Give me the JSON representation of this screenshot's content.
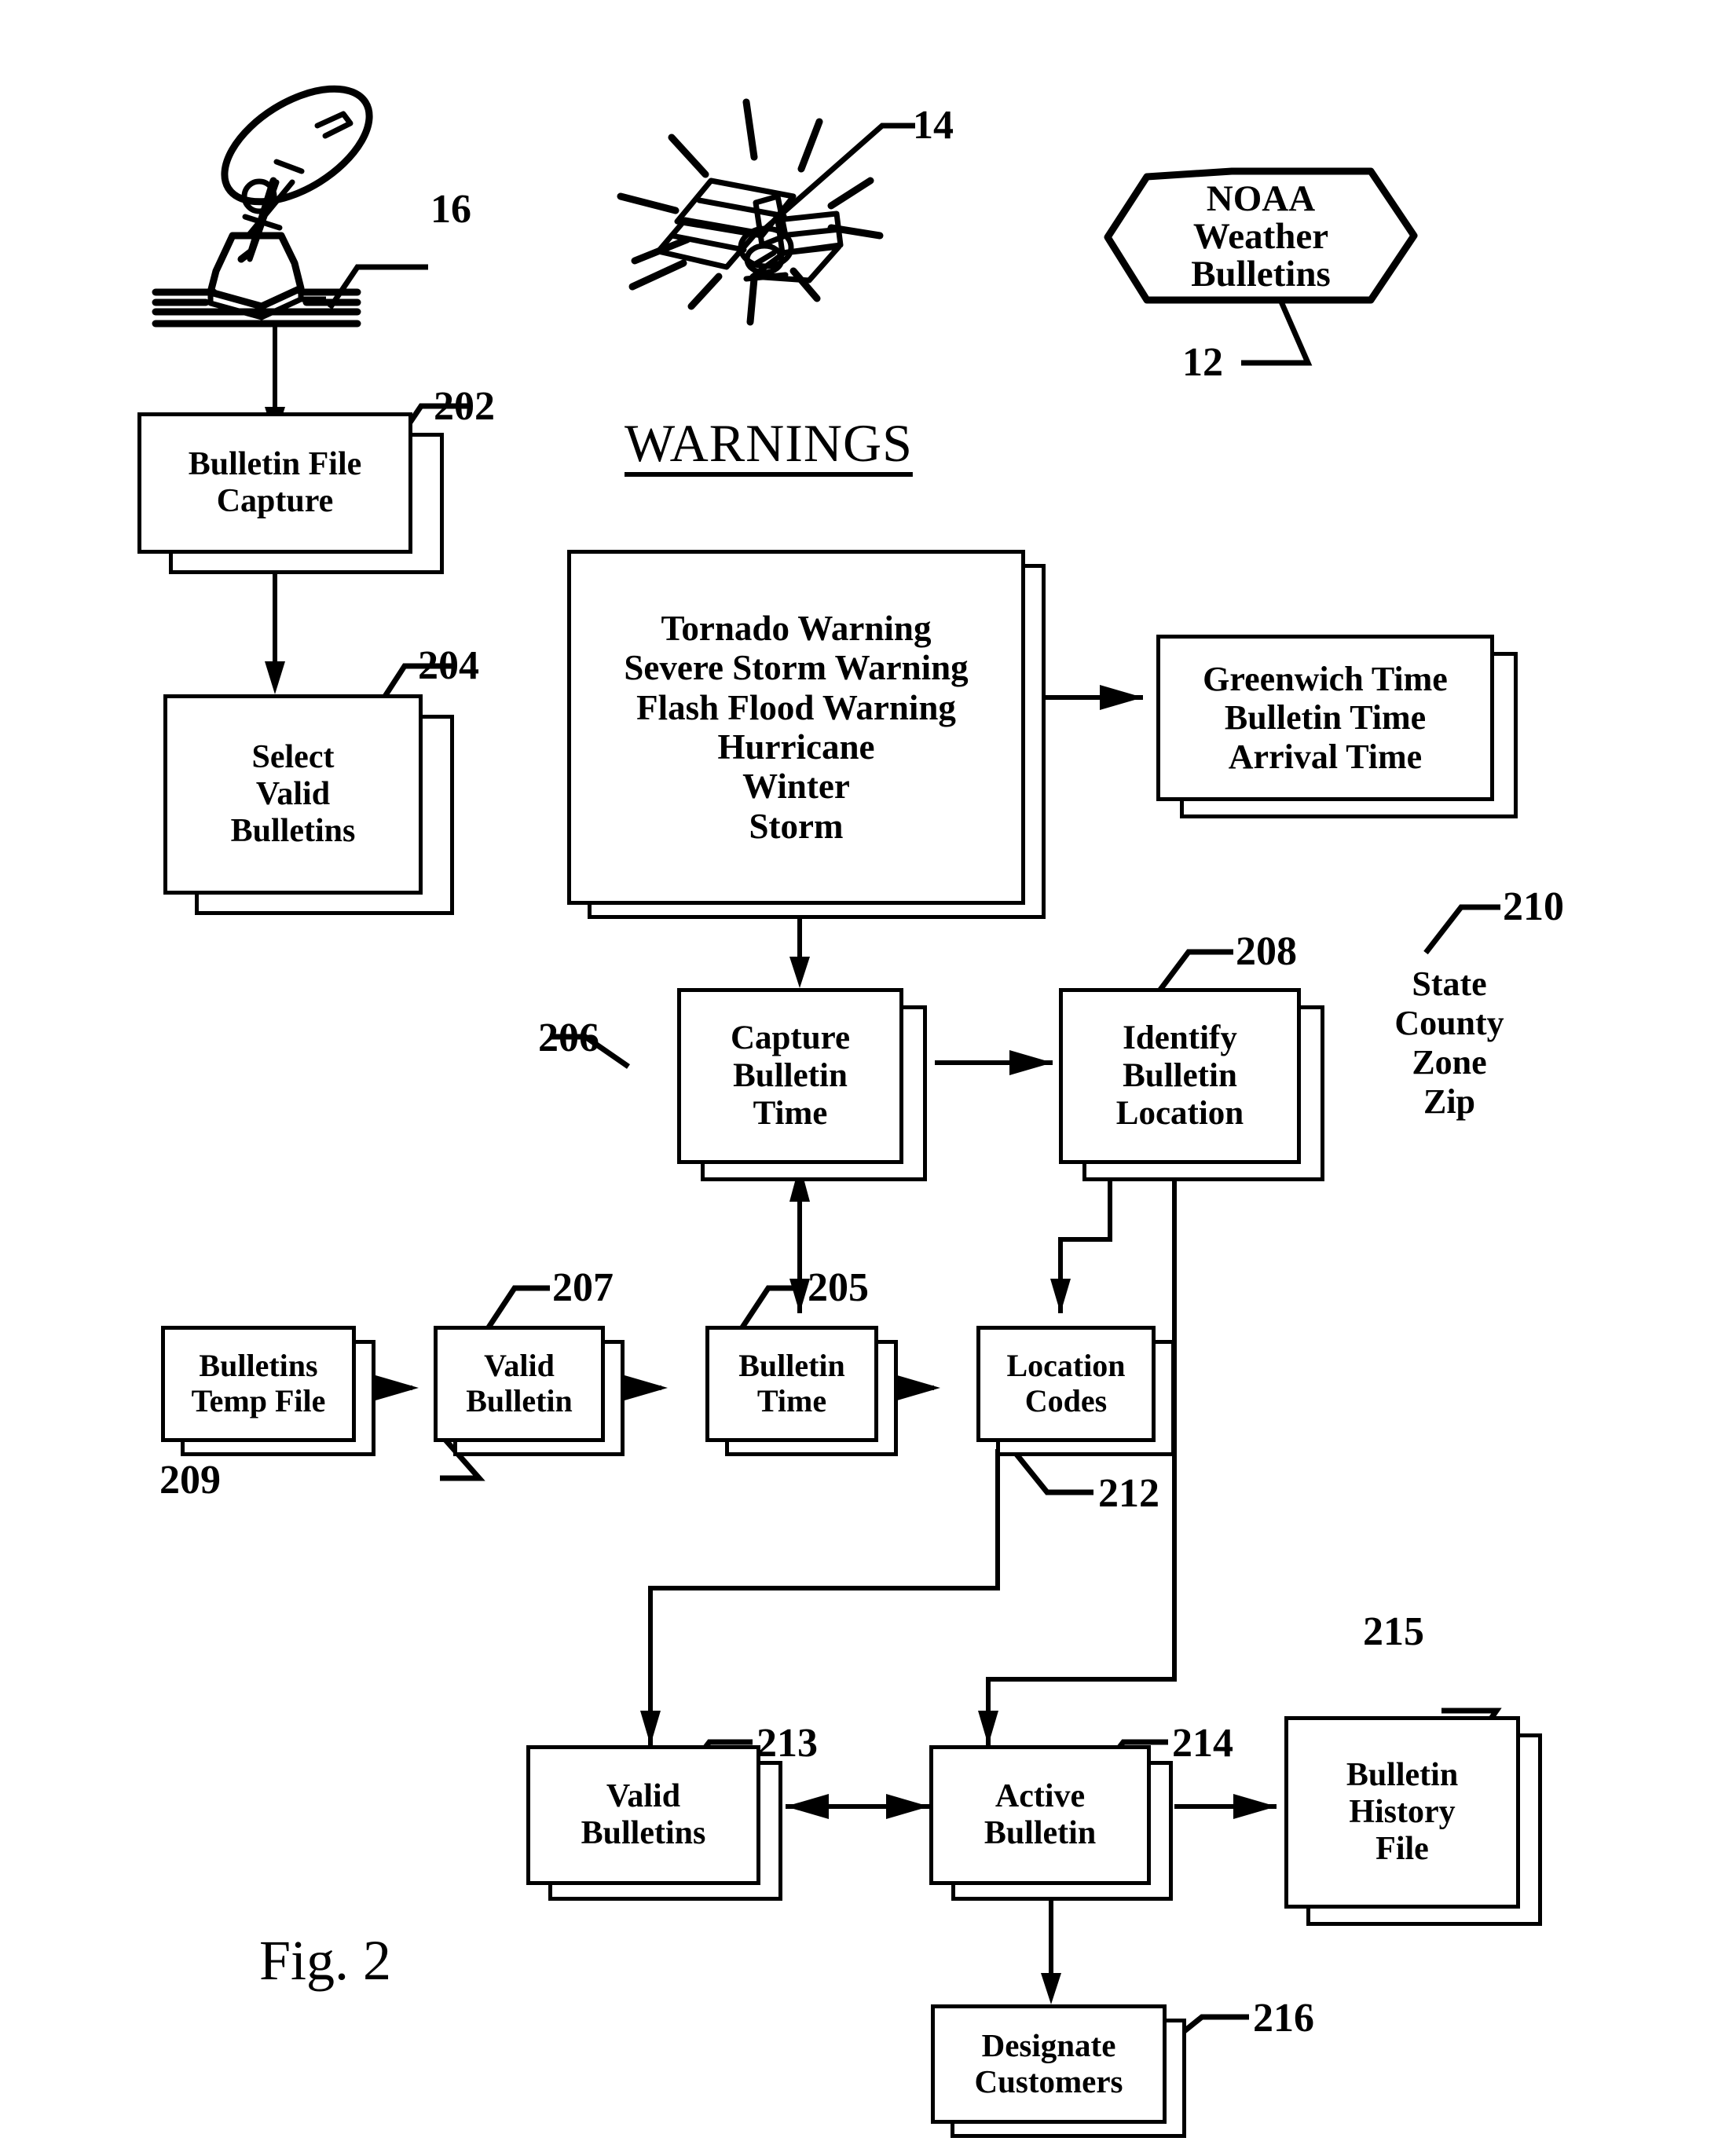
{
  "figure": {
    "label": "Fig. 2",
    "title": "WARNINGS"
  },
  "source_icons": {
    "satellite_dish": {
      "ref": "16",
      "name": "satellite-dish-icon"
    },
    "satellite": {
      "ref": "14",
      "name": "satellite-icon"
    },
    "noaa_badge": {
      "ref": "12",
      "line1": "NOAA",
      "line2": "Weather",
      "line3": "Bulletins"
    }
  },
  "blocks": [
    {
      "id": "b202",
      "ref": "202",
      "text": "Bulletin File\nCapture"
    },
    {
      "id": "b204",
      "ref": "204",
      "text": "Select\nValid\nBulletins"
    },
    {
      "id": "bwarn",
      "ref": "",
      "text": "Tornado Warning\nSevere Storm Warning\nFlash Flood Warning\nHurricane\nWinter\nStorm"
    },
    {
      "id": "btime",
      "ref": "",
      "text": "Greenwich Time\nBulletin Time\nArrival Time"
    },
    {
      "id": "b206",
      "ref": "206",
      "text": "Capture\nBulletin\nTime"
    },
    {
      "id": "b208",
      "ref": "208",
      "text": "Identify\nBulletin\nLocation"
    },
    {
      "id": "b209",
      "ref": "209",
      "text": "Bulletins\nTemp File"
    },
    {
      "id": "b207",
      "ref": "207",
      "text": "Valid\nBulletin"
    },
    {
      "id": "b205",
      "ref": "205",
      "text": "Bulletin\nTime"
    },
    {
      "id": "b212",
      "ref": "212",
      "text": "Location\nCodes"
    },
    {
      "id": "b213",
      "ref": "213",
      "text": "Valid\nBulletins"
    },
    {
      "id": "b214",
      "ref": "214",
      "text": "Active\nBulletin"
    },
    {
      "id": "b215",
      "ref": "215",
      "text": "Bulletin\nHistory\nFile"
    },
    {
      "id": "b216",
      "ref": "216",
      "text": "Designate\nCustomers"
    }
  ],
  "annotations": {
    "location_fields": {
      "ref": "210",
      "text": "State\nCounty\nZone\nZip"
    }
  },
  "refs": {
    "r12": "12",
    "r14": "14",
    "r16": "16",
    "r202": "202",
    "r204": "204",
    "r205": "205",
    "r206": "206",
    "r207": "207",
    "r208": "208",
    "r209": "209",
    "r210": "210",
    "r212": "212",
    "r213": "213",
    "r214": "214",
    "r215": "215",
    "r216": "216"
  },
  "colors": {
    "ink": "#000000",
    "paper": "#ffffff"
  }
}
